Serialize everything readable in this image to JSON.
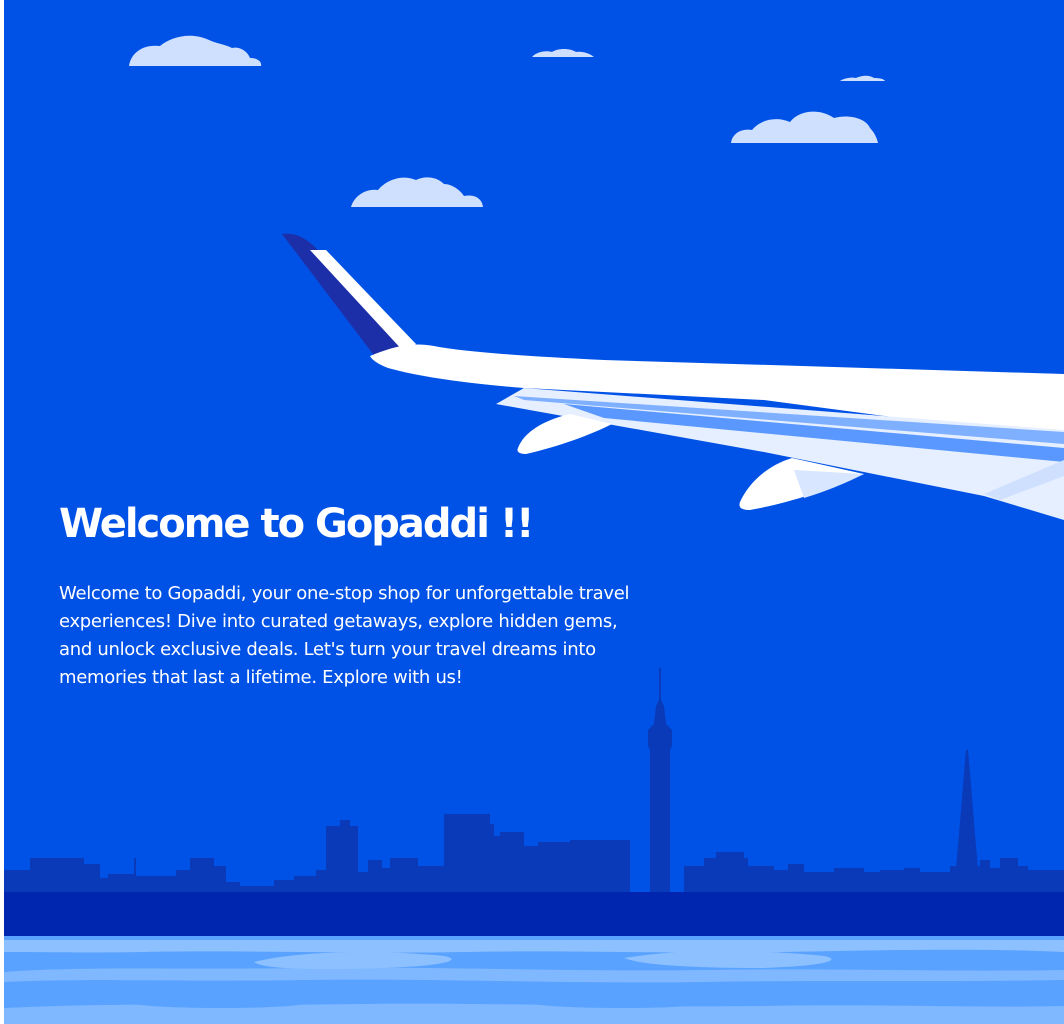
{
  "hero": {
    "title": "Welcome to Gopaddi !!",
    "description": "Welcome to Gopaddi, your one-stop shop for unforgettable travel experiences!  Dive into curated getaways, explore hidden gems, and unlock exclusive deals. Let's turn your travel dreams into memories that last a lifetime. Explore with us!"
  },
  "colors": {
    "sky": "#0052e6",
    "cloud": "#cfe0ff",
    "skyline": "#0a3ab8",
    "skyline_back": "#0635c9",
    "water": "#5aa2ff",
    "wing": "#ffffff",
    "winglet_dark": "#1d2fa8"
  },
  "icons": {
    "illustration": "airplane-wing-over-city-skyline"
  }
}
